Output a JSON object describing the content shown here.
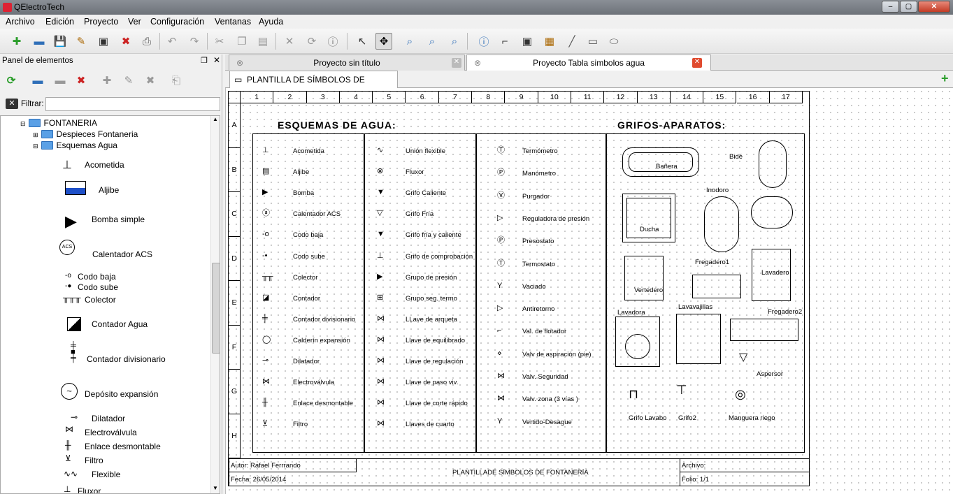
{
  "window": {
    "title": "QElectroTech"
  },
  "menu": [
    "Archivo",
    "Edición",
    "Proyecto",
    "Ver",
    "Configuración",
    "Ventanas",
    "Ayuda"
  ],
  "panel": {
    "title": "Panel de elementos",
    "filter_label": "Filtrar:",
    "filter_value": "",
    "tree": {
      "root": "FONTANERIA",
      "folder1": "Despieces Fontaneria",
      "folder2": "Esquemas Agua",
      "items": [
        "Acometida",
        "Aljibe",
        "Bomba simple",
        "Calentador ACS",
        "Codo baja",
        "Codo sube",
        "Colector",
        "Contador Agua",
        "Contador divisionario",
        "Depósito expansión",
        "Dilatador",
        "Electroválvula",
        "Enlace desmontable",
        "Filtro",
        "Flexible",
        "Fluxor"
      ]
    }
  },
  "project_tabs": [
    {
      "label": "Proyecto sin título"
    },
    {
      "label": "Proyecto Tabla simbolos agua"
    }
  ],
  "folio_tab": "PLANTILLA DE SÍMBOLOS DE FONTANERÍA",
  "sheet": {
    "columns": [
      "1",
      "2",
      "3",
      "4",
      "5",
      "6",
      "7",
      "8",
      "9",
      "10",
      "11",
      "12",
      "13",
      "14",
      "15",
      "16",
      "17"
    ],
    "rows": [
      "A",
      "B",
      "C",
      "D",
      "E",
      "F",
      "G",
      "H"
    ],
    "title_left": "ESQUEMAS DE AGUA:",
    "title_right": "GRIFOS-APARATOS:",
    "col1": [
      "Acometida",
      "Aljibe",
      "Bomba",
      "Calentador ACS",
      "Codo baja",
      "Codo sube",
      "Colector",
      "Contador",
      "Contador divisionario",
      "Calderín expansión",
      "Dilatador",
      "Electroválvula",
      "Enlace desmontable",
      "Filtro"
    ],
    "col2": [
      "Unión flexible",
      "Fluxor",
      "Grifo Caliente",
      "Grifo Fría",
      "Grifo fría y caliente",
      "Grifo de comprobación",
      "Grupo de presión",
      "Grupo seg. termo",
      "LLave de arqueta",
      "Llave de equilibrado",
      "Llave de regulación",
      "Llave de paso viv.",
      "Llave de corte rápido",
      "Llaves  de cuarto"
    ],
    "col3": [
      "Termómetro",
      "Manómetro",
      "Purgador",
      "Reguladora de presión",
      "Presostato",
      "Termostato",
      "Vaciado",
      "Antiretorno",
      "Val. de flotador",
      "Valv de aspiración (pie)",
      "Valv. Seguridad",
      "Valv. zona (3 vías )",
      "Vertido-Desague"
    ],
    "aparatos": [
      "Bañera",
      "Bidé",
      "Ducha",
      "Inodoro",
      "Vertedero",
      "Fregadero1",
      "Lavadero",
      "Lavadora",
      "Lavavajillas",
      "Fregadero2",
      "Aspersor",
      "Grifo Lavabo",
      "Grifo2",
      "Manguera riego"
    ],
    "cartouche": {
      "author": "Autor: Rafael Ferrrando",
      "date": "Fecha: 26/05/2014",
      "title": "PLANTILLADE SÍMBOLOS DE FONTANERÍA",
      "file": "Archivo:",
      "folio": "Folio: 1/1"
    }
  },
  "colors": {
    "accent": "#2f6fb8",
    "close_red": "#e04b2f",
    "add_green": "#2a9d2a"
  }
}
